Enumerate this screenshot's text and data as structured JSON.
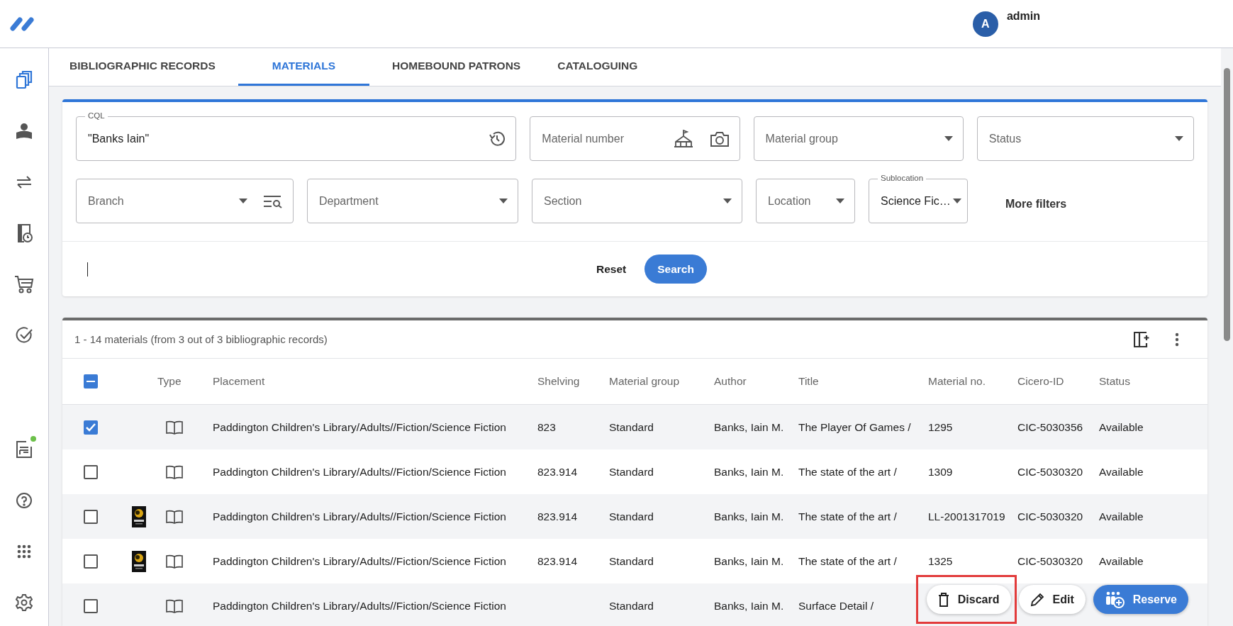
{
  "user": {
    "initial": "A",
    "name": "admin"
  },
  "sidebar": {
    "items": [
      {
        "selected": true,
        "notification": false
      },
      {
        "selected": false,
        "notification": false
      },
      {
        "selected": false,
        "notification": false
      },
      {
        "selected": false,
        "notification": false
      },
      {
        "selected": false,
        "notification": false
      },
      {
        "selected": false,
        "notification": false
      },
      {
        "selected": false,
        "notification": true
      },
      {
        "selected": false,
        "notification": false
      },
      {
        "selected": false,
        "notification": false
      },
      {
        "selected": false,
        "notification": false
      }
    ]
  },
  "tabs": [
    {
      "label": "BIBLIOGRAPHIC RECORDS",
      "selected": false
    },
    {
      "label": "MATERIALS",
      "selected": true
    },
    {
      "label": "HOMEBOUND PATRONS",
      "selected": false
    },
    {
      "label": "CATALOGUING",
      "selected": false
    }
  ],
  "filters": {
    "row_1": [
      {
        "kind": "text",
        "label": "CQL",
        "value": "\"Banks Iain\""
      },
      {
        "kind": "input",
        "placeholder": "Material number"
      },
      {
        "kind": "select",
        "placeholder": "Material group"
      },
      {
        "kind": "select",
        "placeholder": "Status"
      }
    ],
    "row_2": [
      {
        "kind": "select",
        "placeholder": "Branch"
      },
      {
        "kind": "select",
        "placeholder": "Department"
      },
      {
        "kind": "select",
        "placeholder": "Section"
      },
      {
        "kind": "select",
        "placeholder": "Location"
      },
      {
        "kind": "select",
        "label": "Sublocation",
        "value": "Science Fic…"
      }
    ],
    "more_filters": "More filters",
    "reset": "Reset",
    "search": "Search"
  },
  "results": {
    "summary": "1 - 14 materials (from 3 out of 3 bibliographic records)",
    "select_all": {
      "partial": true
    },
    "columns": [
      "Type",
      "Placement",
      "Shelving",
      "Material group",
      "Author",
      "Title",
      "Material no.",
      "Cicero-ID",
      "Status"
    ],
    "rows": [
      {
        "checked": true,
        "cover": false,
        "placement": "Paddington Children's Library/Adults//Fiction/Science Fiction",
        "shelving": "823",
        "material_group": "Standard",
        "author": "Banks, Iain M.",
        "title": "The Player Of Games /",
        "material_no": "1295",
        "cicero_id": "CIC-5030356",
        "status": "Available"
      },
      {
        "checked": false,
        "cover": false,
        "placement": "Paddington Children's Library/Adults//Fiction/Science Fiction",
        "shelving": "823.914",
        "material_group": "Standard",
        "author": "Banks, Iain M.",
        "title": "The state of the art /",
        "material_no": "1309",
        "cicero_id": "CIC-5030320",
        "status": "Available"
      },
      {
        "checked": false,
        "cover": true,
        "placement": "Paddington Children's Library/Adults//Fiction/Science Fiction",
        "shelving": "823.914",
        "material_group": "Standard",
        "author": "Banks, Iain M.",
        "title": "The state of the art /",
        "material_no": "LL-2001317019",
        "cicero_id": "CIC-5030320",
        "status": "Available"
      },
      {
        "checked": false,
        "cover": true,
        "placement": "Paddington Children's Library/Adults//Fiction/Science Fiction",
        "shelving": "823.914",
        "material_group": "Standard",
        "author": "Banks, Iain M.",
        "title": "The state of the art /",
        "material_no": "1325",
        "cicero_id": "CIC-5030320",
        "status": "Available"
      },
      {
        "checked": false,
        "cover": false,
        "placement": "Paddington Children's Library/Adults//Fiction/Science Fiction",
        "material_group": "Standard",
        "author": "Banks, Iain M.",
        "title": "Surface Detail /"
      }
    ]
  },
  "actions": [
    {
      "kind": "discard",
      "label": "Discard",
      "highlighted": true
    },
    {
      "kind": "edit",
      "label": "Edit",
      "highlighted": false
    },
    {
      "kind": "reserve",
      "label": "Reserve",
      "highlighted": false
    }
  ]
}
